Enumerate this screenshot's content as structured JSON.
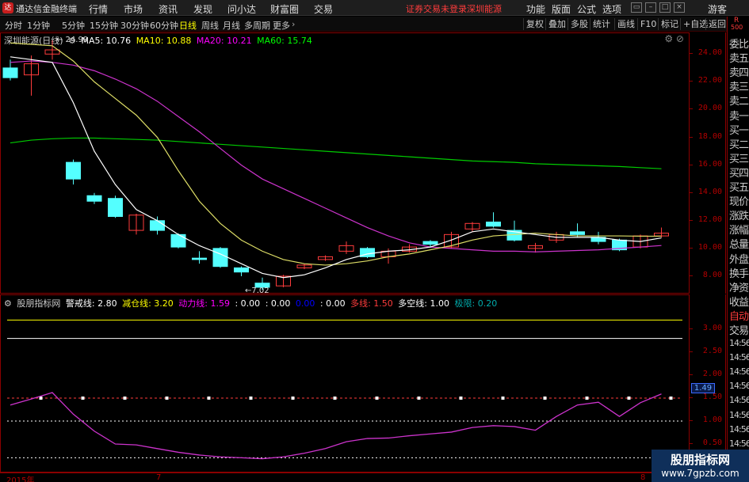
{
  "menubar": {
    "logo": "达",
    "app_name": "通达信金融终端",
    "menus": [
      "行情",
      "市场",
      "资讯",
      "发现",
      "问小达",
      "财富圈",
      "交易"
    ],
    "warning": "证券交易未登录",
    "stock_short": "深圳能源",
    "right_menus": [
      "功能",
      "版面",
      "公式",
      "选项"
    ],
    "user": "游客"
  },
  "toolbar": {
    "periods": [
      "分时",
      "1分钟",
      "5分钟",
      "15分钟",
      "30分钟",
      "60分钟",
      "日线",
      "周线",
      "月线",
      "多周期",
      "更多"
    ],
    "active_period": "日线",
    "buttons": [
      "复权",
      "叠加",
      "多股",
      "统计",
      "画线",
      "F10",
      "标记",
      "+自选",
      "返回"
    ]
  },
  "main_chart": {
    "title": "深圳能源(日线)",
    "ma_labels": [
      {
        "text": "MA5: 10.76",
        "color": "#ffffff"
      },
      {
        "text": "MA10: 10.88",
        "color": "#ffff00"
      },
      {
        "text": "MA20: 10.21",
        "color": "#ff00ff"
      },
      {
        "text": "MA60: 15.74",
        "color": "#00ff00"
      }
    ],
    "high_label": "24.99",
    "low_label": "7.02",
    "y_ticks": [
      "24.00",
      "22.00",
      "20.00",
      "18.00",
      "16.00",
      "14.00",
      "12.00",
      "10.00",
      "8.00"
    ]
  },
  "indicator": {
    "name": "股朋指标网",
    "values": [
      {
        "text": "警戒线: 2.80",
        "color": "#ffffff"
      },
      {
        "text": "减仓线: 3.20",
        "color": "#ffff00"
      },
      {
        "text": "动力线: 1.59",
        "color": "#ff00ff"
      },
      {
        "text": ": 0.00",
        "color": "#ffffff"
      },
      {
        "text": ": 0.00",
        "color": "#ffffff"
      },
      {
        "text": "0.00",
        "color": "#0000ff"
      },
      {
        "text": ": 0.00",
        "color": "#ffffff"
      },
      {
        "text": "多线: 1.50",
        "color": "#ff3c3c"
      },
      {
        "text": "多空线: 1.00",
        "color": "#ffffff"
      },
      {
        "text": "极限: 0.20",
        "color": "#00aaaa"
      }
    ],
    "y_ticks": [
      "3.00",
      "2.50",
      "2.00",
      "1.50",
      "1.00",
      "0.50"
    ],
    "current_value": "1.49"
  },
  "side_panel": [
    "委比",
    "卖五",
    "卖四",
    "卖三",
    "卖二",
    "卖一",
    "买一",
    "买二",
    "买三",
    "买四",
    "买五",
    "现价",
    "涨跌",
    "涨幅",
    "总量",
    "外盘",
    "换手",
    "净资",
    "收益",
    "自动",
    "交易",
    "14:56",
    "14:56",
    "14:56",
    "14:56",
    "14:56",
    "14:56",
    "14:56",
    "14:56",
    "14:56"
  ],
  "side_top": {
    "r": "R",
    "n": "500"
  },
  "x_labels": [
    "2015年",
    "7",
    "8"
  ],
  "watermark": {
    "line1": "股朋指标网",
    "line2": "www.7gpzb.com"
  },
  "chart_data": [
    {
      "type": "candlestick",
      "title": "深圳能源(日线)",
      "ylim": [
        7.0,
        25.0
      ],
      "candles": [
        {
          "o": 23.0,
          "c": 22.3,
          "h": 23.6,
          "l": 22.1
        },
        {
          "o": 22.5,
          "c": 23.3,
          "h": 23.9,
          "l": 21.0
        },
        {
          "o": 24.0,
          "c": 24.3,
          "h": 24.99,
          "l": 23.6
        },
        {
          "o": 16.2,
          "c": 15.0,
          "h": 16.4,
          "l": 14.6
        },
        {
          "o": 13.8,
          "c": 13.4,
          "h": 14.0,
          "l": 13.2
        },
        {
          "o": 13.6,
          "c": 12.3,
          "h": 13.8,
          "l": 12.2
        },
        {
          "o": 11.3,
          "c": 12.4,
          "h": 12.5,
          "l": 11.0
        },
        {
          "o": 12.0,
          "c": 11.3,
          "h": 12.3,
          "l": 11.0
        },
        {
          "o": 11.0,
          "c": 10.1,
          "h": 11.1,
          "l": 10.0
        },
        {
          "o": 9.3,
          "c": 9.2,
          "h": 9.8,
          "l": 8.9
        },
        {
          "o": 10.0,
          "c": 8.7,
          "h": 10.1,
          "l": 8.6
        },
        {
          "o": 8.6,
          "c": 8.3,
          "h": 8.7,
          "l": 8.0
        },
        {
          "o": 7.5,
          "c": 7.2,
          "h": 7.9,
          "l": 7.02
        },
        {
          "o": 7.3,
          "c": 8.0,
          "h": 8.1,
          "l": 7.2
        },
        {
          "o": 8.6,
          "c": 8.8,
          "h": 8.9,
          "l": 8.5
        },
        {
          "o": 9.2,
          "c": 9.4,
          "h": 9.5,
          "l": 9.1
        },
        {
          "o": 9.8,
          "c": 10.2,
          "h": 10.5,
          "l": 9.6
        },
        {
          "o": 10.0,
          "c": 9.4,
          "h": 10.1,
          "l": 9.3
        },
        {
          "o": 9.4,
          "c": 9.8,
          "h": 10.0,
          "l": 8.9
        },
        {
          "o": 9.8,
          "c": 10.1,
          "h": 10.3,
          "l": 9.7
        },
        {
          "o": 10.5,
          "c": 10.3,
          "h": 10.6,
          "l": 10.1
        },
        {
          "o": 10.1,
          "c": 11.0,
          "h": 11.2,
          "l": 10.0
        },
        {
          "o": 11.4,
          "c": 11.8,
          "h": 11.9,
          "l": 11.2
        },
        {
          "o": 11.9,
          "c": 11.6,
          "h": 12.6,
          "l": 11.5
        },
        {
          "o": 11.3,
          "c": 10.6,
          "h": 12.0,
          "l": 10.5
        },
        {
          "o": 10.0,
          "c": 10.2,
          "h": 10.4,
          "l": 9.7
        },
        {
          "o": 10.6,
          "c": 11.0,
          "h": 11.2,
          "l": 10.4
        },
        {
          "o": 11.2,
          "c": 11.0,
          "h": 11.8,
          "l": 10.8
        },
        {
          "o": 10.8,
          "c": 10.5,
          "h": 11.2,
          "l": 10.3
        },
        {
          "o": 10.6,
          "c": 9.9,
          "h": 10.7,
          "l": 9.8
        },
        {
          "o": 10.1,
          "c": 10.9,
          "h": 11.0,
          "l": 10.0
        },
        {
          "o": 10.9,
          "c": 11.1,
          "h": 11.5,
          "l": 10.8
        }
      ],
      "ma5": [
        23.8,
        23.6,
        23.4,
        20.5,
        17.0,
        14.6,
        12.8,
        12.0,
        11.0,
        10.2,
        9.6,
        8.9,
        8.2,
        7.9,
        8.1,
        8.6,
        9.2,
        9.6,
        9.8,
        9.9,
        10.1,
        10.6,
        11.2,
        11.4,
        11.2,
        11.0,
        10.8,
        10.8,
        10.8,
        10.6,
        10.5,
        10.76
      ],
      "ma10": [
        24.8,
        24.7,
        24.6,
        23.5,
        22.0,
        20.8,
        19.6,
        18.0,
        15.6,
        13.4,
        11.8,
        10.6,
        9.8,
        9.2,
        8.9,
        8.8,
        8.9,
        9.1,
        9.4,
        9.6,
        9.9,
        10.2,
        10.6,
        10.9,
        11.0,
        11.1,
        11.0,
        10.9,
        10.9,
        10.9,
        10.88,
        10.88
      ],
      "ma20": [
        23.4,
        23.5,
        23.4,
        23.2,
        22.8,
        22.2,
        21.5,
        20.6,
        19.5,
        18.4,
        17.2,
        16.0,
        15.0,
        14.3,
        13.6,
        12.9,
        12.2,
        11.5,
        10.9,
        10.4,
        10.1,
        10.0,
        9.9,
        9.8,
        9.8,
        9.75,
        9.8,
        9.85,
        9.9,
        10.0,
        10.1,
        10.21
      ],
      "ma60": [
        17.6,
        17.8,
        17.9,
        17.95,
        17.95,
        17.9,
        17.85,
        17.8,
        17.7,
        17.6,
        17.5,
        17.4,
        17.3,
        17.2,
        17.1,
        17.0,
        16.9,
        16.8,
        16.7,
        16.6,
        16.5,
        16.4,
        16.3,
        16.25,
        16.2,
        16.1,
        16.05,
        16.0,
        15.95,
        15.9,
        15.82,
        15.74
      ]
    },
    {
      "type": "line",
      "title": "股朋指标网",
      "ylim": [
        0.0,
        3.5
      ],
      "series": [
        {
          "name": "动力线",
          "values": [
            1.35,
            1.48,
            1.62,
            1.15,
            0.78,
            0.5,
            0.48,
            0.4,
            0.32,
            0.26,
            0.22,
            0.2,
            0.18,
            0.22,
            0.3,
            0.4,
            0.55,
            0.62,
            0.63,
            0.68,
            0.72,
            0.76,
            0.86,
            0.9,
            0.88,
            0.8,
            1.1,
            1.35,
            1.41,
            1.1,
            1.4,
            1.59
          ]
        },
        {
          "name": "警戒线",
          "values": [
            2.8,
            2.8
          ]
        },
        {
          "name": "减仓线",
          "values": [
            3.2,
            3.2
          ]
        },
        {
          "name": "多线",
          "values": [
            1.5,
            1.5
          ]
        },
        {
          "name": "多空线",
          "values": [
            1.0,
            1.0
          ]
        },
        {
          "name": "极限",
          "values": [
            0.2,
            0.2
          ]
        }
      ]
    }
  ]
}
